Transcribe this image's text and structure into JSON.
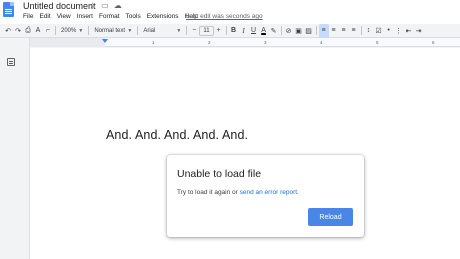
{
  "header": {
    "doc_title": "Untitled document",
    "title_icons": [
      "star-icon",
      "move-to-folder-icon",
      "cloud-status-icon"
    ],
    "menu": [
      "File",
      "Edit",
      "View",
      "Insert",
      "Format",
      "Tools",
      "Extensions",
      "Help"
    ],
    "last_edit": "Last edit was seconds ago"
  },
  "toolbar": {
    "zoom": "200%",
    "style": "Normal text",
    "font": "Arial",
    "font_size": "11"
  },
  "ruler": {
    "ticks": [
      "1",
      "2",
      "3",
      "4",
      "5",
      "6"
    ]
  },
  "document": {
    "text": "And. And. And. And. And."
  },
  "dialog": {
    "title": "Unable to load file",
    "body_prefix": "Try to load it again or ",
    "link": "send an error report",
    "body_suffix": ".",
    "button": "Reload"
  },
  "colors": {
    "accent": "#4a86e8",
    "link": "#1a73e8",
    "doc_icon": "#4285f4"
  }
}
